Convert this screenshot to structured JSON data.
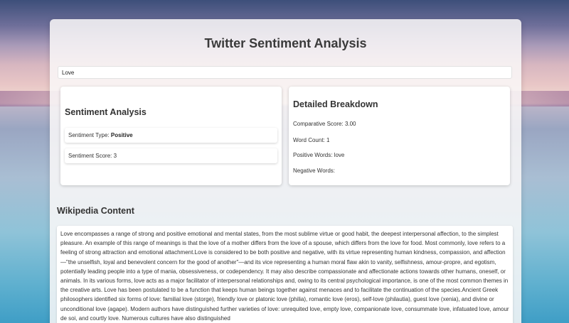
{
  "app": {
    "title": "Twitter Sentiment Analysis"
  },
  "search": {
    "value": "Love"
  },
  "sentiment": {
    "heading": "Sentiment Analysis",
    "type_label": "Sentiment Type:",
    "type_value": "Positive",
    "score_label": "Sentiment Score:",
    "score_value": "3"
  },
  "breakdown": {
    "heading": "Detailed Breakdown",
    "comparative_label": "Comparative Score:",
    "comparative_value": "3.00",
    "word_count_label": "Word Count:",
    "word_count_value": "1",
    "positive_label": "Positive Words:",
    "positive_value": "love",
    "negative_label": "Negative Words:",
    "negative_value": ""
  },
  "wikipedia": {
    "heading": "Wikipedia Content",
    "content": "Love encompasses a range of strong and positive emotional and mental states, from the most sublime virtue or good habit, the deepest interpersonal affection, to the simplest pleasure. An example of this range of meanings is that the love of a mother differs from the love of a spouse, which differs from the love for food. Most commonly, love refers to a feeling of strong attraction and emotional attachment.Love is considered to be both positive and negative, with its virtue representing human kindness, compassion, and affection—\"the unselfish, loyal and benevolent concern for the good of another\"—and its vice representing a human moral flaw akin to vanity, selfishness, amour-propre, and egotism, potentially leading people into a type of mania, obsessiveness, or codependency. It may also describe compassionate and affectionate actions towards other humans, oneself, or animals. In its various forms, love acts as a major facilitator of interpersonal relationships and, owing to its central psychological importance, is one of the most common themes in the creative arts. Love has been postulated to be a function that keeps human beings together against menaces and to facilitate the continuation of the species.Ancient Greek philosophers identified six forms of love: familial love (storge), friendly love or platonic love (philia), romantic love (eros), self-love (philautia), guest love (xenia), and divine or unconditional love (agape). Modern authors have distinguished further varieties of love: unrequited love, empty love, companionate love, consummate love, infatuated love, amour de soi, and courtly love. Numerous cultures have also distinguished"
  }
}
